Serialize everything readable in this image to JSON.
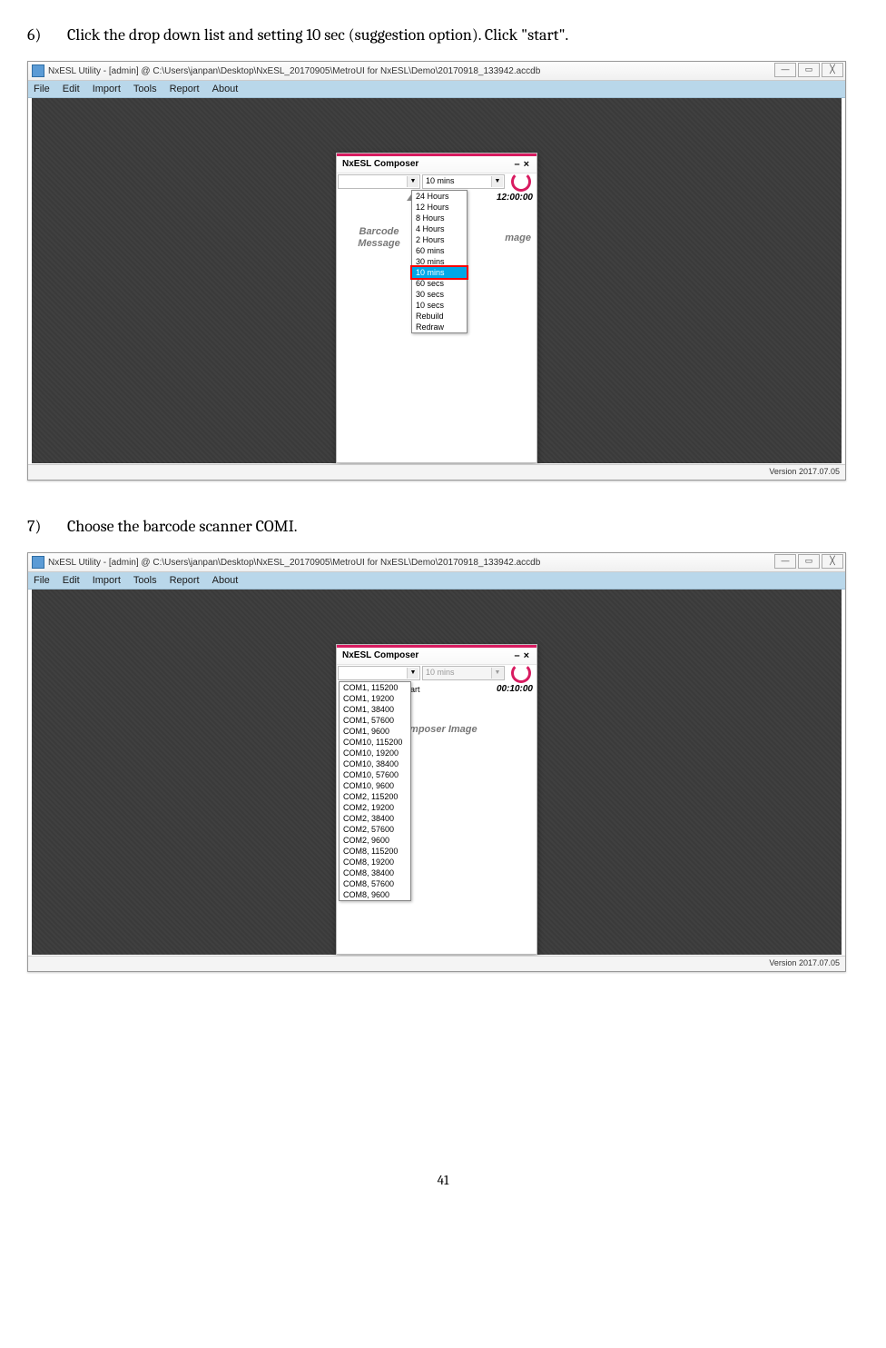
{
  "steps": {
    "s6_num": "6)",
    "s6_text": "Click the drop down list and setting 10 sec (suggestion option). Click \"start\".",
    "s7_num": "7)",
    "s7_text": "Choose the barcode scanner COMI."
  },
  "app": {
    "title": "NxESL Utility - [admin] @ C:\\Users\\janpan\\Desktop\\NxESL_20170905\\MetroUI for NxESL\\Demo\\20170918_133942.accdb",
    "menu": [
      "File",
      "Edit",
      "Import",
      "Tools",
      "Report",
      "About"
    ],
    "version": "Version 2017.07.05"
  },
  "composer": {
    "title": "NxESL Composer",
    "min": "–",
    "close": "×",
    "combo_left_blank": "",
    "combo_time_value": "10 mins",
    "combo_time_disabled": "10 mins",
    "start_label": "Start",
    "timer1": "12:00:00",
    "timer2": "00:10:00",
    "barcode": "Barcode\nMessage",
    "barcode_line1": "Barcode",
    "barcode_line2": "Message",
    "image_label": "Composer Image",
    "image_suffix": "mage"
  },
  "time_options": [
    "24 Hours",
    "12 Hours",
    "8 Hours",
    "4 Hours",
    "2 Hours",
    "60 mins",
    "30 mins",
    "10 mins",
    "60 secs",
    "30 secs",
    "10 secs",
    "Rebuild",
    "Redraw"
  ],
  "time_selected": "10 mins",
  "com_options": [
    "COM1, 115200",
    "COM1, 19200",
    "COM1, 38400",
    "COM1, 57600",
    "COM1, 9600",
    "COM10, 115200",
    "COM10, 19200",
    "COM10, 38400",
    "COM10, 57600",
    "COM10, 9600",
    "COM2, 115200",
    "COM2, 19200",
    "COM2, 38400",
    "COM2, 57600",
    "COM2, 9600",
    "COM8, 115200",
    "COM8, 19200",
    "COM8, 38400",
    "COM8, 57600",
    "COM8, 9600"
  ],
  "page_number": "41"
}
